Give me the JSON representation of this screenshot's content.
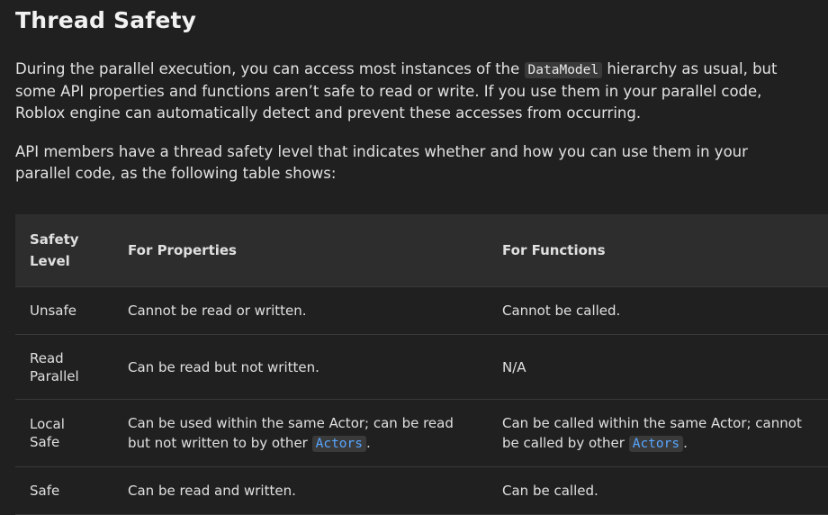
{
  "heading": "Thread Safety",
  "para1": {
    "before": "During the parallel execution, you can access most instances of the ",
    "code": "DataModel",
    "after": " hierarchy as usual, but some API properties and functions aren’t safe to read or write. If you use them in your parallel code, Roblox engine can automatically detect and prevent these accesses from occurring."
  },
  "para2": "API members have a thread safety level that indicates whether and how you can use them in your parallel code, as the following table shows:",
  "table": {
    "headers": {
      "level_line1": "Safety",
      "level_line2": "Level",
      "properties": "For Properties",
      "functions": "For Functions"
    },
    "rows": [
      {
        "level_line1": "Unsafe",
        "level_line2": "",
        "properties": "Cannot be read or written.",
        "functions": "Cannot be called."
      },
      {
        "level_line1": "Read",
        "level_line2": "Parallel",
        "properties": "Can be read but not written.",
        "functions": "N/A"
      },
      {
        "level_line1": "Local",
        "level_line2": "Safe",
        "properties_before": "Can be used within the same Actor; can be read but not written to by other ",
        "properties_link": "Actors",
        "properties_after": ".",
        "functions_before": "Can be called within the same Actor; cannot be called by other ",
        "functions_link": "Actors",
        "functions_after": "."
      },
      {
        "level_line1": "Safe",
        "level_line2": "",
        "properties": "Can be read and written.",
        "functions": "Can be called."
      }
    ]
  },
  "colors": {
    "background": "#202020",
    "header_row": "#2d2d2d",
    "link": "#58a6ff"
  }
}
